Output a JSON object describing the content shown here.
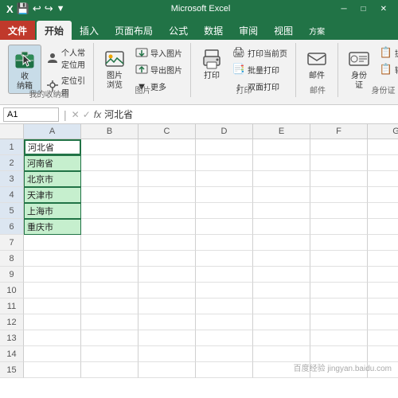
{
  "titlebar": {
    "title": "Microsoft Excel"
  },
  "ribbon": {
    "tabs": [
      "文件",
      "开始",
      "插入",
      "页面布局",
      "公式",
      "数据",
      "审阅",
      "视图",
      "方案"
    ],
    "active_tab": "开始",
    "file_tab": "文件",
    "groups": [
      {
        "name": "我的收纳箱",
        "label": "我的收纳箱",
        "buttons": [
          {
            "icon": "📥",
            "label": "收\n纳箱",
            "active": true
          },
          {
            "icon": "👤",
            "label": "个人常\n定位用"
          },
          {
            "icon": "📌",
            "label": "定位引\n用"
          }
        ]
      },
      {
        "name": "图片",
        "label": "图片",
        "buttons": [
          {
            "icon": "🖼️",
            "label": "图片\n浏览"
          },
          {
            "icon": "📤",
            "label": "导入图片"
          },
          {
            "icon": "📥",
            "label": "导出图片"
          },
          {
            "icon": "▼",
            "label": "更多"
          }
        ]
      },
      {
        "name": "打印",
        "label": "打印",
        "buttons": [
          {
            "icon": "🖨️",
            "label": "打印"
          },
          {
            "icon": "📄",
            "label": "打印当前页"
          },
          {
            "icon": "🔄",
            "label": "批量打印"
          },
          {
            "icon": "↕️",
            "label": "双面打印"
          }
        ]
      },
      {
        "name": "邮件",
        "label": "邮件",
        "buttons": [
          {
            "icon": "✉️",
            "label": "邮件"
          }
        ]
      },
      {
        "name": "身份证",
        "label": "身份证",
        "buttons": [
          {
            "icon": "🪪",
            "label": "身份\n证"
          }
        ]
      },
      {
        "name": "身份证2",
        "label": "身份证",
        "buttons": [
          {
            "icon": "📋",
            "label": "提取他"
          },
          {
            "icon": "📋",
            "label": "输入机"
          }
        ]
      }
    ]
  },
  "formula_bar": {
    "name_box": "A1",
    "formula": "河北省"
  },
  "spreadsheet": {
    "col_headers": [
      "A",
      "B",
      "C",
      "D",
      "E",
      "F",
      "G"
    ],
    "rows": [
      {
        "num": 1,
        "cells": [
          "河北省",
          "",
          "",
          "",
          "",
          "",
          ""
        ]
      },
      {
        "num": 2,
        "cells": [
          "河南省",
          "",
          "",
          "",
          "",
          "",
          ""
        ]
      },
      {
        "num": 3,
        "cells": [
          "北京市",
          "",
          "",
          "",
          "",
          "",
          ""
        ]
      },
      {
        "num": 4,
        "cells": [
          "天津市",
          "",
          "",
          "",
          "",
          "",
          ""
        ]
      },
      {
        "num": 5,
        "cells": [
          "上海市",
          "",
          "",
          "",
          "",
          "",
          ""
        ]
      },
      {
        "num": 6,
        "cells": [
          "重庆市",
          "",
          "",
          "",
          "",
          "",
          ""
        ]
      },
      {
        "num": 7,
        "cells": [
          "",
          "",
          "",
          "",
          "",
          "",
          ""
        ]
      },
      {
        "num": 8,
        "cells": [
          "",
          "",
          "",
          "",
          "",
          "",
          ""
        ]
      },
      {
        "num": 9,
        "cells": [
          "",
          "",
          "",
          "",
          "",
          "",
          ""
        ]
      },
      {
        "num": 10,
        "cells": [
          "",
          "",
          "",
          "",
          "",
          "",
          ""
        ]
      },
      {
        "num": 11,
        "cells": [
          "",
          "",
          "",
          "",
          "",
          "",
          ""
        ]
      },
      {
        "num": 12,
        "cells": [
          "",
          "",
          "",
          "",
          "",
          "",
          ""
        ]
      },
      {
        "num": 13,
        "cells": [
          "",
          "",
          "",
          "",
          "",
          "",
          ""
        ]
      },
      {
        "num": 14,
        "cells": [
          "",
          "",
          "",
          "",
          "",
          "",
          ""
        ]
      },
      {
        "num": 15,
        "cells": [
          "",
          "",
          "",
          "",
          "",
          "",
          ""
        ]
      }
    ]
  },
  "watermark": "百度经验 jingyan.baidu.com"
}
